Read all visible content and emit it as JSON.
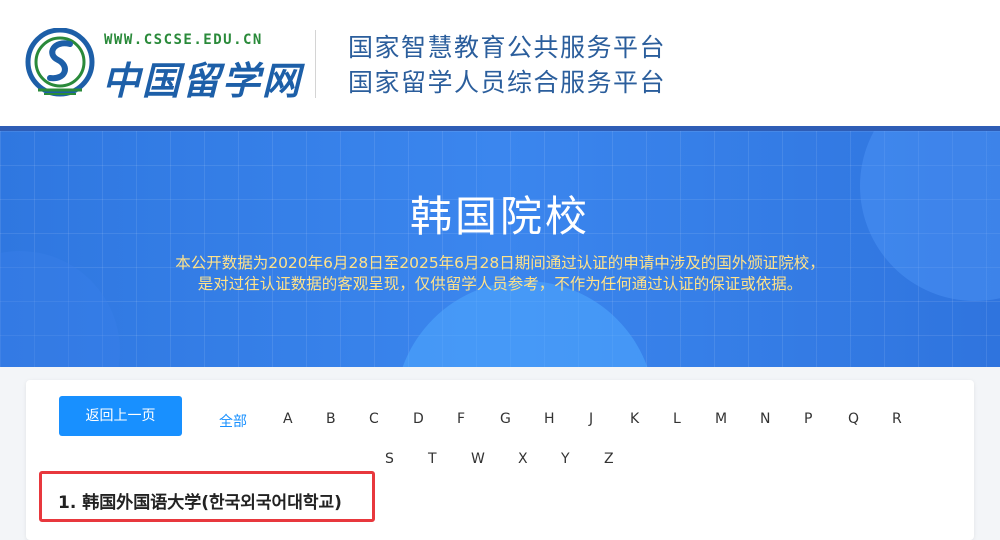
{
  "header": {
    "logo_url_text": "WWW.CSCSE.EDU.CN",
    "logo_name": "中国留学网",
    "title_line1": "国家智慧教育公共服务平台",
    "title_line2": "国家留学人员综合服务平台",
    "colors": {
      "brand_blue": "#2b5e9c",
      "logo_green": "#2a8a3a"
    }
  },
  "banner": {
    "title": "韩国院校",
    "desc_line1": "本公开数据为2020年6月28日至2025年6月28日期间通过认证的申请中涉及的国外颁证院校，",
    "desc_line2": "是对过往认证数据的客观呈现，仅供留学人员参考，不作为任何通过认证的保证或依据。",
    "colors": {
      "background": "#3b86ee",
      "desc_text": "#ffe28a"
    }
  },
  "content": {
    "back_button_label": "返回上一页",
    "filter_all": "全部",
    "letters": [
      "A",
      "B",
      "C",
      "D",
      "F",
      "G",
      "H",
      "J",
      "K",
      "L",
      "M",
      "N",
      "P",
      "Q",
      "R",
      "S",
      "T",
      "W",
      "X",
      "Y",
      "Z"
    ],
    "results": [
      {
        "index": "1.",
        "name": "韩国外国语大学(한국외국어대학교)"
      }
    ],
    "colors": {
      "accent": "#1890ff",
      "highlight_border": "#e8383d"
    }
  }
}
